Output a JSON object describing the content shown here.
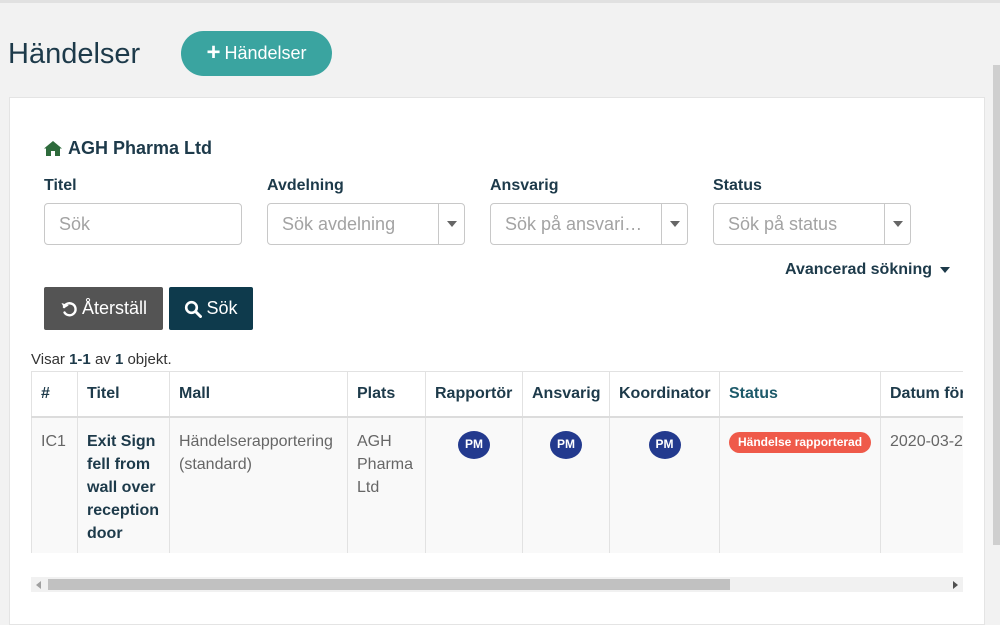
{
  "header": {
    "title": "Händelser",
    "add_button_label": "Händelser",
    "add_icon": "plus-icon"
  },
  "breadcrumb": {
    "icon": "home-icon",
    "organization": "AGH Pharma Ltd"
  },
  "filters": {
    "title_label": "Titel",
    "title_placeholder": "Sök",
    "department_label": "Avdelning",
    "department_placeholder": "Sök avdelning",
    "responsible_label": "Ansvarig",
    "responsible_placeholder": "Sök på ansvarig person",
    "status_label": "Status",
    "status_placeholder": "Sök på status",
    "advanced_label": "Avancerad sökning"
  },
  "actions": {
    "reset_label": "Återställ",
    "reset_icon": "undo-icon",
    "search_label": "Sök",
    "search_icon": "search-icon"
  },
  "summary": {
    "prefix": "Visar",
    "range": "1-1",
    "middle": "av",
    "total": "1",
    "suffix": "objekt."
  },
  "table": {
    "columns": [
      "#",
      "Titel",
      "Mall",
      "Plats",
      "Rapportör",
      "Ansvarig",
      "Koordinator",
      "Status",
      "Datum för"
    ],
    "rows": [
      {
        "id": "IC1",
        "title": "Exit Sign fell from wall over reception door",
        "template": "Händelserapportering (standard)",
        "location": "AGH Pharma Ltd",
        "reporter": "PM",
        "responsible": "PM",
        "coordinator": "PM",
        "status": "Händelse rapporterad",
        "date": "2020-03-2"
      }
    ]
  },
  "colors": {
    "accent": "#3aa4a0",
    "primary_dark": "#0e3a4c",
    "avatar": "#233a8e",
    "status_badge": "#ef5a4a"
  }
}
